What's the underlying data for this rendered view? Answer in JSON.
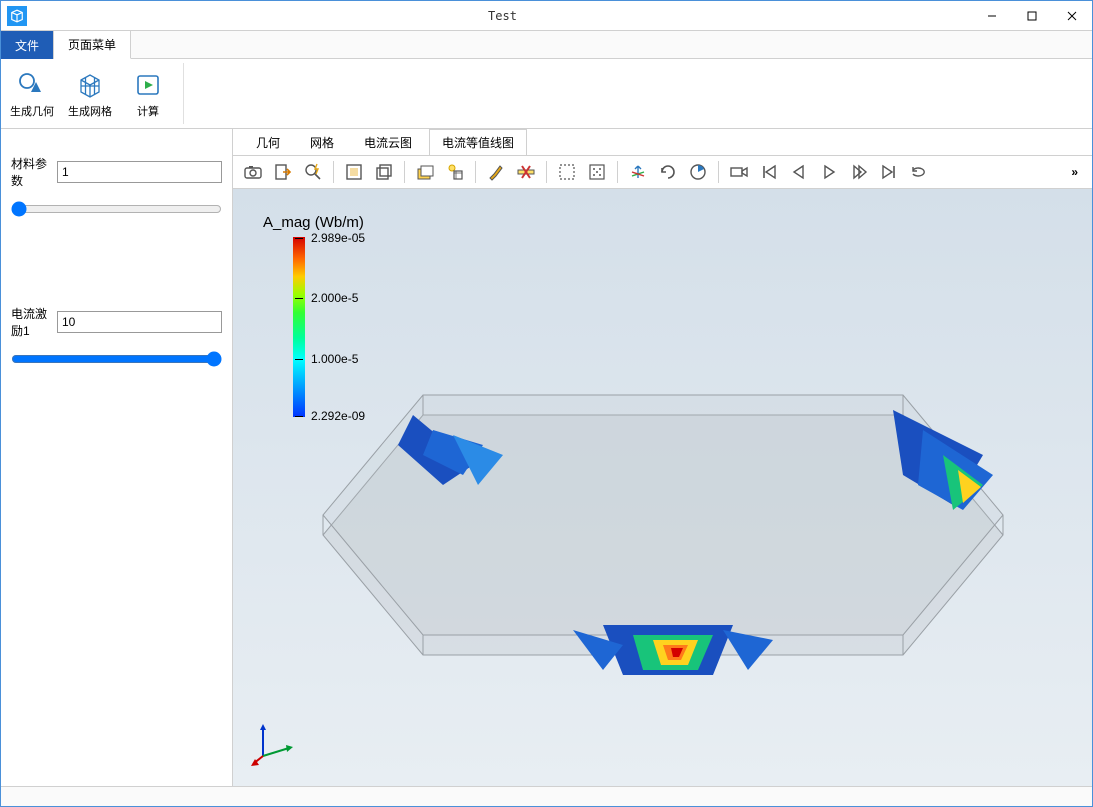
{
  "window": {
    "title": "Test"
  },
  "menu": {
    "file": "文件",
    "pageMenu": "页面菜单"
  },
  "ribbon": {
    "genGeometry": "生成几何",
    "genMesh": "生成网格",
    "compute": "计算"
  },
  "sidebar": {
    "param1_label": "材料参数",
    "param1_value": "1",
    "param2_label": "电流激励1",
    "param2_value": "10"
  },
  "viewTabs": {
    "geometry": "几何",
    "mesh": "网格",
    "currentCloud": "电流云图",
    "currentContour": "电流等值线图"
  },
  "toolbar": {
    "icons": [
      "camera-icon",
      "export-icon",
      "zoom-flash-icon",
      "select-rect-icon",
      "select-box-icon",
      "layer-rect-icon",
      "lightbulb-cube-icon",
      "brush-icon",
      "ruler-cross-icon",
      "marquee-icon",
      "center-dots-icon",
      "axis-rotate-icon",
      "rotate-cw-icon",
      "pie-clock-icon",
      "video-camera-icon",
      "skip-start-icon",
      "step-back-icon",
      "play-icon",
      "step-forward-icon",
      "skip-end-icon",
      "loop-icon"
    ],
    "more": "»"
  },
  "legend": {
    "title": "A_mag (Wb/m)",
    "ticks": [
      {
        "v": "2.989e-05",
        "pos": 0
      },
      {
        "v": "2.000e-5",
        "pos": 33
      },
      {
        "v": "1.000e-5",
        "pos": 67
      },
      {
        "v": "2.292e-09",
        "pos": 100
      }
    ]
  },
  "colors": {
    "accent": "#1f5db6",
    "borderBlue": "#4a90d9"
  }
}
